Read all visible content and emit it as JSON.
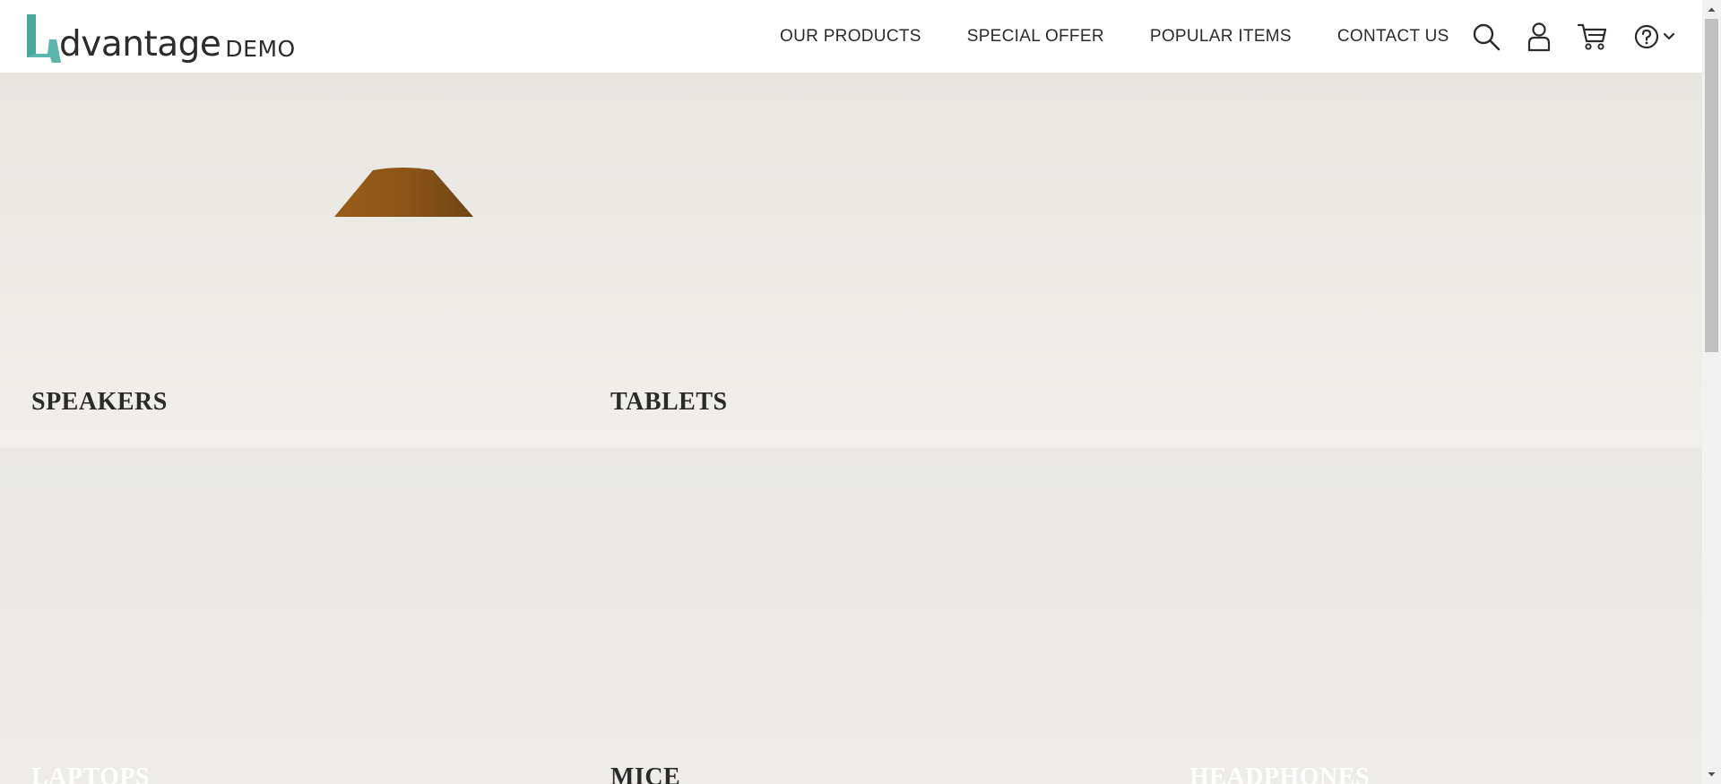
{
  "brand": {
    "name": "dvantage",
    "suffix": "DEMO",
    "accent_color": "#5bb7ae",
    "text_color": "#2b2b2b"
  },
  "nav": {
    "items": [
      {
        "label": "OUR PRODUCTS"
      },
      {
        "label": "SPECIAL OFFER"
      },
      {
        "label": "POPULAR ITEMS"
      },
      {
        "label": "CONTACT US"
      }
    ]
  },
  "header_icons": [
    "search-icon",
    "user-icon",
    "cart-icon",
    "help-icon",
    "chevron-down-icon"
  ],
  "categories": {
    "speakers": {
      "label": "SPEAKERS"
    },
    "tablets": {
      "label": "TABLETS"
    },
    "laptops": {
      "label": "LAPTOPS"
    },
    "mice": {
      "label": "MICE"
    },
    "headphones": {
      "label": "HEADPHONES"
    }
  },
  "colors": {
    "panel_background": "#ebe9e5",
    "speaker_product": "#8b5518",
    "scrollbar_thumb": "#c1c1c1"
  }
}
